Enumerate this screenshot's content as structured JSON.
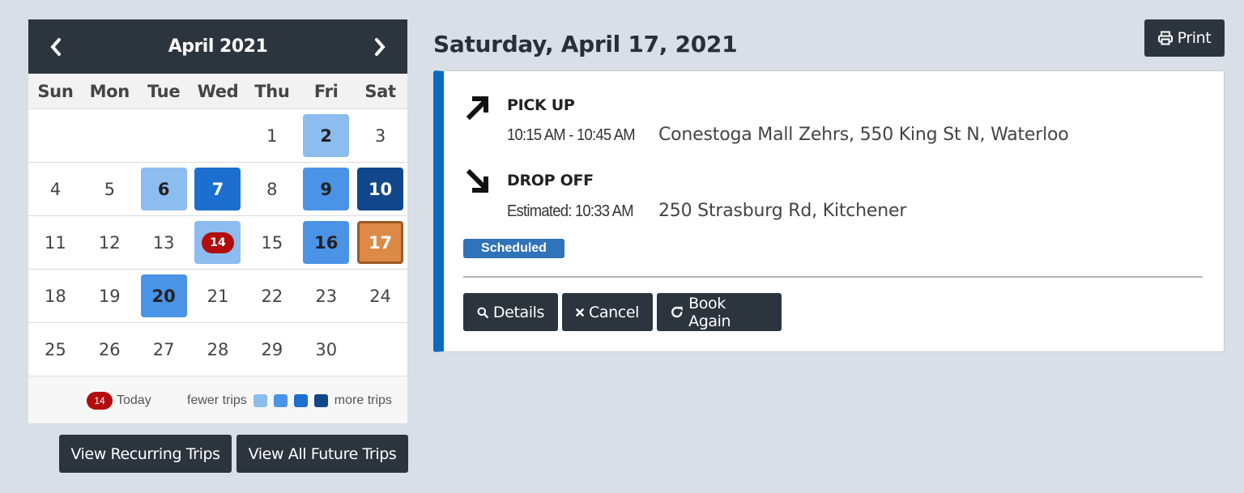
{
  "calendar": {
    "month_title": "April 2021",
    "prev_icon": "chevron-left-icon",
    "next_icon": "chevron-right-icon",
    "weekdays": [
      "Sun",
      "Mon",
      "Tue",
      "Wed",
      "Thu",
      "Fri",
      "Sat"
    ],
    "weeks": [
      [
        {
          "d": ""
        },
        {
          "d": ""
        },
        {
          "d": ""
        },
        {
          "d": ""
        },
        {
          "d": "1"
        },
        {
          "d": "2",
          "level": 1
        },
        {
          "d": "3"
        }
      ],
      [
        {
          "d": "4"
        },
        {
          "d": "5"
        },
        {
          "d": "6",
          "level": 1
        },
        {
          "d": "7",
          "level": 3
        },
        {
          "d": "8"
        },
        {
          "d": "9",
          "level": 2
        },
        {
          "d": "10",
          "level": 4
        }
      ],
      [
        {
          "d": "11"
        },
        {
          "d": "12"
        },
        {
          "d": "13"
        },
        {
          "d": "14",
          "level": 1,
          "today": true
        },
        {
          "d": "15"
        },
        {
          "d": "16",
          "level": 2
        },
        {
          "d": "17",
          "selected": true
        }
      ],
      [
        {
          "d": "18"
        },
        {
          "d": "19"
        },
        {
          "d": "20",
          "level": 2
        },
        {
          "d": "21"
        },
        {
          "d": "22"
        },
        {
          "d": "23"
        },
        {
          "d": "24"
        }
      ],
      [
        {
          "d": "25"
        },
        {
          "d": "26"
        },
        {
          "d": "27"
        },
        {
          "d": "28"
        },
        {
          "d": "29"
        },
        {
          "d": "30"
        },
        {
          "d": ""
        }
      ]
    ],
    "legend": {
      "today_number": "14",
      "today_label": "Today",
      "fewer_label": "fewer trips",
      "more_label": "more trips",
      "scale_colors": [
        "#8dbcef",
        "#4a93e6",
        "#1c6fcf",
        "#12478c"
      ]
    }
  },
  "bottom_buttons": {
    "recurring": "View Recurring Trips",
    "future": "View All Future Trips"
  },
  "detail": {
    "date_title": "Saturday, April 17, 2021",
    "print_label": "Print",
    "print_icon": "printer-icon",
    "pickup": {
      "label": "PICK UP",
      "icon": "arrow-up-right-icon",
      "time": "10:15 AM - 10:45 AM",
      "address": "Conestoga Mall Zehrs, 550 King St N, Waterloo"
    },
    "dropoff": {
      "label": "DROP OFF",
      "icon": "arrow-down-right-icon",
      "time": "Estimated: 10:33 AM",
      "address": "250 Strasburg Rd, Kitchener"
    },
    "status": "Scheduled",
    "actions": {
      "details": "Details",
      "cancel": "Cancel",
      "book_again": "Book Again"
    }
  },
  "colors": {
    "header": "#2c343d",
    "selected": "#dc8a45",
    "today": "#b30c0c",
    "accent": "#0a6abf"
  }
}
